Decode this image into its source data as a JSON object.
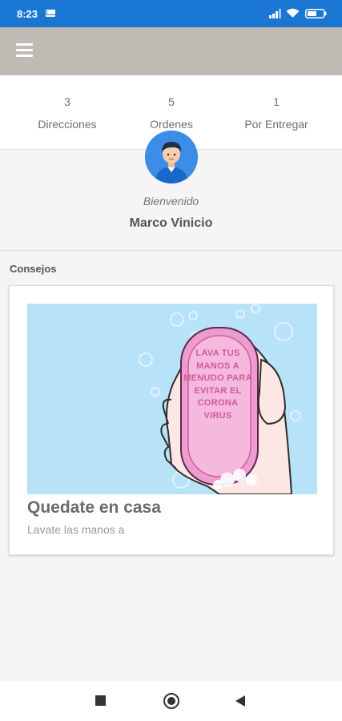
{
  "status_bar": {
    "time": "8:23",
    "icons": [
      "mail-icon",
      "signal-icon",
      "wifi-icon",
      "battery-icon"
    ],
    "color": "#1976d2"
  },
  "app_bar": {
    "icon": "menu-icon",
    "color": "#bfbab4"
  },
  "stats": [
    {
      "value": "3",
      "label": "Direcciones"
    },
    {
      "value": "5",
      "label": "Ordenes"
    },
    {
      "value": "1",
      "label": "Por Entregar"
    }
  ],
  "profile": {
    "welcome": "Bienvenido",
    "name": "Marco Vinicio",
    "avatar_icon": "user-avatar-icon",
    "avatar_color": "#3b8de7"
  },
  "tips": {
    "section_title": "Consejos",
    "cards": [
      {
        "image_text": "LAVA TUS MANOS A MENUDO PARA EVITAR EL CORONA VIRUS",
        "title": "Quedate en casa",
        "subtitle": "Lavate las manos a"
      }
    ]
  },
  "nav_bar": {
    "icons": [
      "recents-square-icon",
      "home-circle-icon",
      "back-triangle-icon"
    ]
  }
}
